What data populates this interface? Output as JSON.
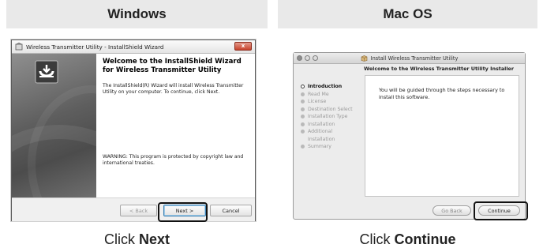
{
  "headers": {
    "windows": "Windows",
    "mac": "Mac OS"
  },
  "windows_dialog": {
    "title": "Wireless Transmitter Utility - InstallShield Wizard",
    "close_label": "x",
    "heading": "Welcome to the InstallShield Wizard for Wireless Transmitter Utility",
    "body": "The InstallShield(R) Wizard will install Wireless Transmitter Utility on your computer. To continue, click Next.",
    "warning": "WARNING: This program is protected by copyright law and international treaties.",
    "buttons": {
      "back": "< Back",
      "next": "Next >",
      "cancel": "Cancel"
    }
  },
  "mac_dialog": {
    "title": "Install Wireless Transmitter Utility",
    "welcome": "Welcome to the Wireless Transmitter Utility Installer",
    "steps": [
      "Introduction",
      "Read Me",
      "License",
      "Destination Select",
      "Installation Type",
      "Installation",
      "Additional Installation",
      "Summary"
    ],
    "active_step": "Introduction",
    "body": "You will be guided through the steps necessary to install this software.",
    "buttons": {
      "go_back": "Go Back",
      "continue": "Continue"
    }
  },
  "captions": {
    "windows": {
      "verb": "Click",
      "target": "Next"
    },
    "mac": {
      "verb": "Click",
      "target": "Continue"
    }
  },
  "colors": {
    "header_bg": "#e9e9e9",
    "highlight_border": "#111111"
  }
}
